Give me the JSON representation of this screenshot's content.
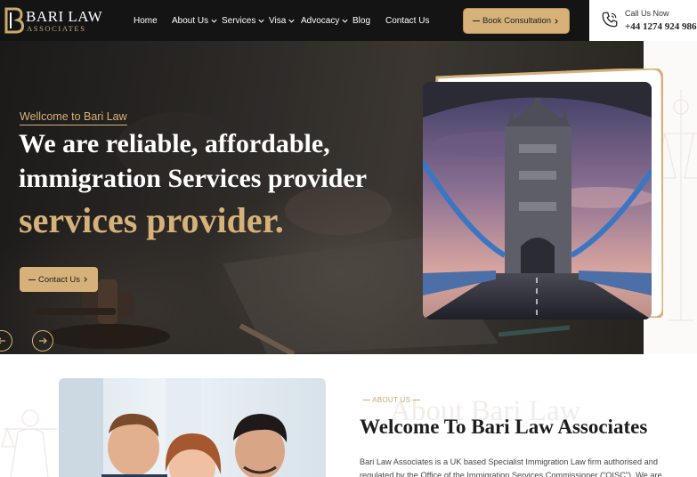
{
  "brand": {
    "title": "BARI LAW",
    "subtitle": "ASSOCIATES",
    "colors": {
      "gold": "#d6b27a",
      "dark": "#141414"
    }
  },
  "nav": {
    "items": [
      {
        "label": "Home",
        "has_dropdown": false
      },
      {
        "label": "About Us",
        "has_dropdown": true
      },
      {
        "label": "Services",
        "has_dropdown": true
      },
      {
        "label": "Visa",
        "has_dropdown": true
      },
      {
        "label": "Advocacy",
        "has_dropdown": true
      },
      {
        "label": "Blog",
        "has_dropdown": false
      },
      {
        "label": "Contact Us",
        "has_dropdown": false
      }
    ]
  },
  "header": {
    "book_label": "Book Consultation",
    "call_label": "Call Us Now",
    "phone": "+44 1274 924 986"
  },
  "hero": {
    "welcome": "Wellcome to Bari Law",
    "line1": "We are reliable, affordable,",
    "line2": "immigration Services provider",
    "line3": "services provider.",
    "contact_label": "Contact Us"
  },
  "about": {
    "tag": "ABOUT US",
    "watermark": "About Bari Law",
    "title": "Welcome To Bari Law Associates",
    "text": "Bari Law Associates is a UK based Specialist Immigration Law firm authorised and regulated by the Office of the Immigration Services Commissioner (\"OISC\"). We are"
  }
}
